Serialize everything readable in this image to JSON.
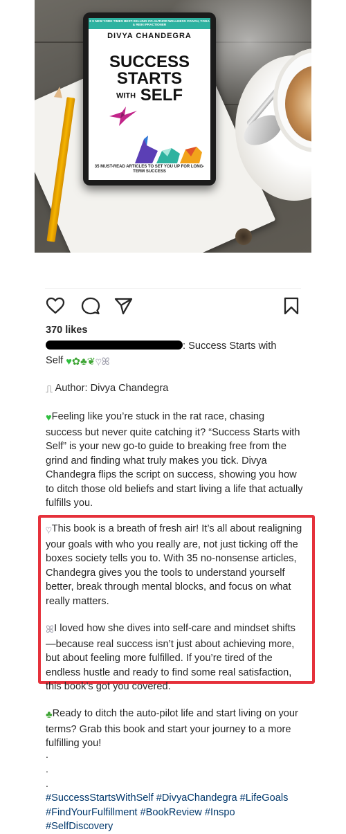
{
  "post_image": {
    "book": {
      "banner": "2 X NEW YORK TIMES BEST-SELLING CO-AUTHOR WELLNESS COACH, YOGA & REIKI PRACTIONER",
      "author": "DIVYA CHANDEGRA",
      "title_line1": "SUCCESS",
      "title_line2": "STARTS",
      "title_with": "WITH",
      "title_self": "SELF",
      "subtitle": "35 MUST-READ ARTICLES TO SET YOU UP FOR LONG-TERM SUCCESS"
    }
  },
  "actions": {
    "like_icon": "heart-outline-icon",
    "comment_icon": "comment-bubble-icon",
    "share_icon": "paper-plane-icon",
    "save_icon": "bookmark-icon"
  },
  "likes": "370 likes",
  "caption": {
    "headline_suffix": ": Success Starts with",
    "headline_line2": "Self",
    "author_line": "Author: Divya Chandegra",
    "para1": "Feeling like you’re stuck in the rat race, chasing success but never quite catching it? “Success Starts with Self” is your new go-to guide to breaking free from the grind and finding what truly makes you tick. Divya Chandegra flips the script on success, showing you how to ditch those old beliefs and start living a life that actually fulfills you.",
    "para2": "This book is a breath of fresh air! It’s all about realigning your goals with who you really are, not just ticking off the boxes society tells you to. With 35 no-nonsense articles, Chandegra gives you the tools to understand yourself better, break through mental blocks, and focus on what really matters.",
    "para3": "I loved how she dives into self-care and mindset shifts—because real success isn’t just about achieving more, but about feeling more fulfilled. If you’re tired of the endless hustle and ready to find some real satisfaction, this book’s got you covered.",
    "para4": "Ready to ditch the auto-pilot life and start living on your terms? Grab this book and start your journey to a more fulfilling you!",
    "dot": "."
  },
  "hashtags": "#SuccessStartsWithSelf #DivyaChandegra #LifeGoals #FindYourFulfillment #BookReview #Inspo #SelfDiscovery",
  "colors": {
    "highlight_border": "#e5313b",
    "hashtag": "#00376b",
    "book_band": "#2eb2a0"
  }
}
